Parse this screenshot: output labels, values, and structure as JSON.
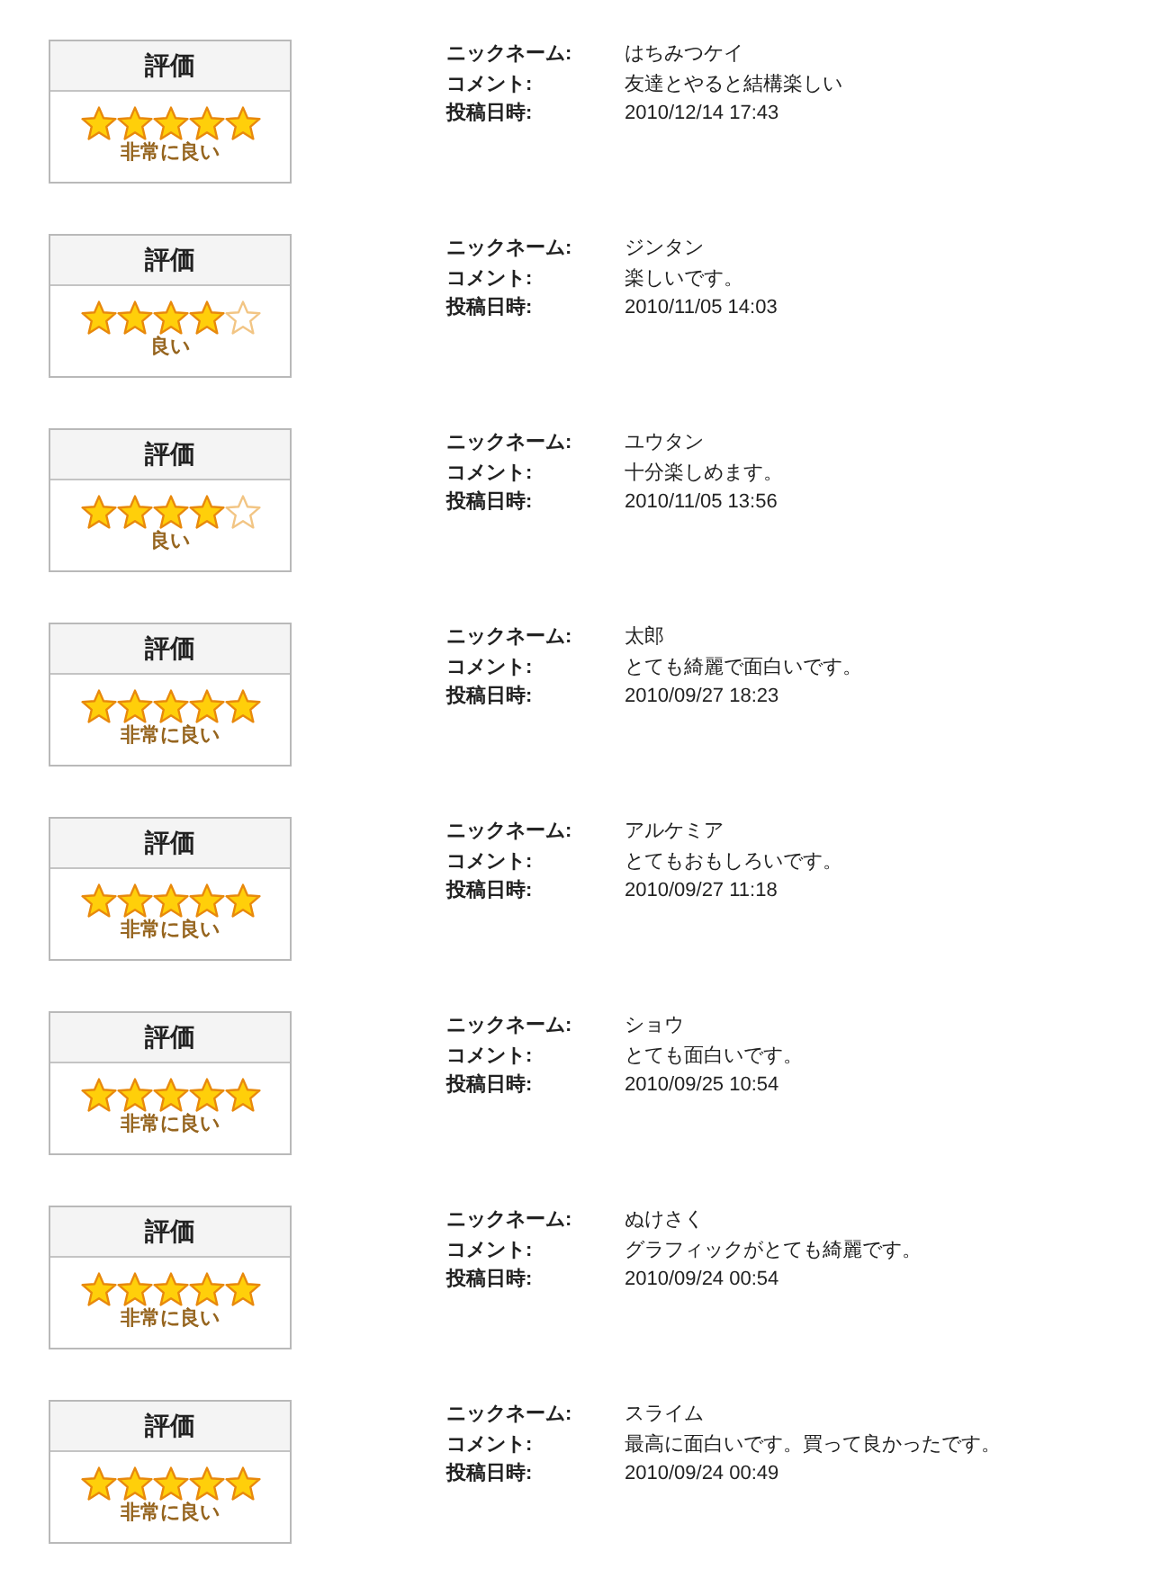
{
  "reviews": [
    {
      "rating_header": "評価",
      "stars": 5,
      "rating_label": "非常に良い",
      "fields": [
        {
          "label": "ニックネーム:",
          "value": "はちみつケイ"
        },
        {
          "label": "コメント:",
          "value": "友達とやると結構楽しい"
        },
        {
          "label": "投稿日時:",
          "value": "2010/12/14 17:43"
        }
      ]
    },
    {
      "rating_header": "評価",
      "stars": 4,
      "rating_label": "良い",
      "fields": [
        {
          "label": "ニックネーム:",
          "value": "ジンタン"
        },
        {
          "label": "コメント:",
          "value": "楽しいです。"
        },
        {
          "label": "投稿日時:",
          "value": "2010/11/05 14:03"
        }
      ]
    },
    {
      "rating_header": "評価",
      "stars": 4,
      "rating_label": "良い",
      "fields": [
        {
          "label": "ニックネーム:",
          "value": "ユウタン"
        },
        {
          "label": "コメント:",
          "value": "十分楽しめます。"
        },
        {
          "label": "投稿日時:",
          "value": "2010/11/05 13:56"
        }
      ]
    },
    {
      "rating_header": "評価",
      "stars": 5,
      "rating_label": "非常に良い",
      "fields": [
        {
          "label": "ニックネーム:",
          "value": "太郎"
        },
        {
          "label": "コメント:",
          "value": "とても綺麗で面白いです。"
        },
        {
          "label": "投稿日時:",
          "value": "2010/09/27 18:23"
        }
      ]
    },
    {
      "rating_header": "評価",
      "stars": 5,
      "rating_label": "非常に良い",
      "fields": [
        {
          "label": "ニックネーム:",
          "value": "アルケミア"
        },
        {
          "label": "コメント:",
          "value": "とてもおもしろいです。"
        },
        {
          "label": "投稿日時:",
          "value": "2010/09/27 11:18"
        }
      ]
    },
    {
      "rating_header": "評価",
      "stars": 5,
      "rating_label": "非常に良い",
      "fields": [
        {
          "label": "ニックネーム:",
          "value": "ショウ"
        },
        {
          "label": "コメント:",
          "value": "とても面白いです。"
        },
        {
          "label": "投稿日時:",
          "value": "2010/09/25 10:54"
        }
      ]
    },
    {
      "rating_header": "評価",
      "stars": 5,
      "rating_label": "非常に良い",
      "fields": [
        {
          "label": "ニックネーム:",
          "value": "ぬけさく"
        },
        {
          "label": "コメント:",
          "value": "グラフィックがとても綺麗です。"
        },
        {
          "label": "投稿日時:",
          "value": "2010/09/24 00:54"
        }
      ]
    },
    {
      "rating_header": "評価",
      "stars": 5,
      "rating_label": "非常に良い",
      "fields": [
        {
          "label": "ニックネーム:",
          "value": "スライム"
        },
        {
          "label": "コメント:",
          "value": "最高に面白いです。買って良かったです。"
        },
        {
          "label": "投稿日時:",
          "value": "2010/09/24 00:49"
        }
      ]
    }
  ]
}
